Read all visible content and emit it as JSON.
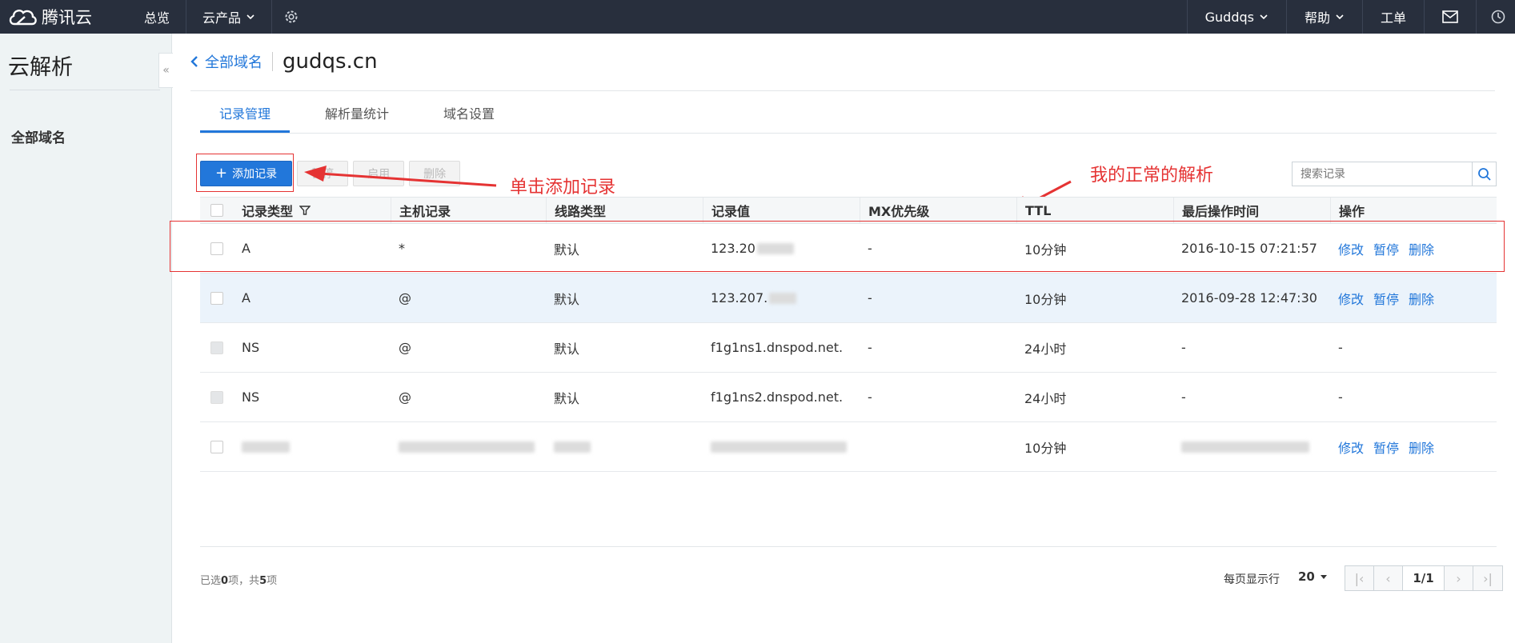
{
  "topbar": {
    "brand": "腾讯云",
    "nav": [
      "总览",
      "云产品"
    ],
    "user": "Guddqs",
    "help": "帮助",
    "ticket": "工单"
  },
  "sidebar": {
    "title": "云解析",
    "item": "全部域名"
  },
  "breadcrumb": {
    "back": "全部域名",
    "domain": "gudqs.cn"
  },
  "tabs": [
    "记录管理",
    "解析量统计",
    "域名设置"
  ],
  "toolbar": {
    "add": "添加记录",
    "pause": "暂停",
    "enable": "启用",
    "delete": "删除"
  },
  "search": {
    "placeholder": "搜索记录"
  },
  "annotations": {
    "add_hint": "单击添加记录",
    "normal_hint": "我的正常的解析"
  },
  "table": {
    "headers": [
      "记录类型",
      "主机记录",
      "线路类型",
      "记录值",
      "MX优先级",
      "TTL",
      "最后操作时间",
      "操作"
    ],
    "rows": [
      {
        "type": "A",
        "host": "*",
        "line": "默认",
        "value": "123.20",
        "mx": "-",
        "ttl": "10分钟",
        "time": "2016-10-15 07:21:57",
        "actions": [
          "修改",
          "暂停",
          "删除"
        ]
      },
      {
        "type": "A",
        "host": "@",
        "line": "默认",
        "value": "123.207.",
        "mx": "-",
        "ttl": "10分钟",
        "time": "2016-09-28 12:47:30",
        "actions": [
          "修改",
          "暂停",
          "删除"
        ]
      },
      {
        "type": "NS",
        "host": "@",
        "line": "默认",
        "value": "f1g1ns1.dnspod.net.",
        "mx": "-",
        "ttl": "24小时",
        "time": "-",
        "actions_text": "-"
      },
      {
        "type": "NS",
        "host": "@",
        "line": "默认",
        "value": "f1g1ns2.dnspod.net.",
        "mx": "-",
        "ttl": "24小时",
        "time": "-",
        "actions_text": "-"
      },
      {
        "type": "",
        "host": "",
        "line": "",
        "value": "",
        "mx": "",
        "ttl": "10分钟",
        "time": "",
        "actions": [
          "修改",
          "暂停",
          "删除"
        ]
      }
    ]
  },
  "footer": {
    "selected_prefix": "已选",
    "selected_count": "0",
    "selected_mid": "项，共",
    "total": "5",
    "selected_suffix": "项",
    "per_page_label": "每页显示行",
    "per_page": "20",
    "page": "1/1"
  }
}
